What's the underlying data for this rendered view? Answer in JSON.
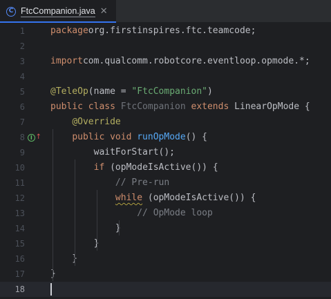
{
  "tab": {
    "file_icon_letter": "C",
    "title": "FtcCompanion.java",
    "close_glyph": "✕",
    "icon": "java-class-icon"
  },
  "editor": {
    "current_line": 18,
    "gutter_marker": {
      "line": 8,
      "letter": "I",
      "arrow": "↑",
      "icon": "implements-method-icon"
    },
    "lines": [
      {
        "num": "1",
        "tokens": [
          [
            "kw",
            "package"
          ],
          [
            "",
            "org.firstinspires.ftc.teamcode;"
          ]
        ]
      },
      {
        "num": "2",
        "tokens": []
      },
      {
        "num": "3",
        "tokens": [
          [
            "kw",
            "import"
          ],
          [
            "",
            "com.qualcomm.robotcore.eventloop.opmode.*;"
          ]
        ]
      },
      {
        "num": "4",
        "tokens": []
      },
      {
        "num": "5",
        "tokens": [
          [
            "ann",
            "@TeleOp"
          ],
          [
            "",
            "(name = "
          ],
          [
            "str",
            "\"FtcCompanion\""
          ],
          [
            "",
            ")"
          ]
        ]
      },
      {
        "num": "6",
        "tokens": [
          [
            "kw",
            "public class "
          ],
          [
            "dim",
            "FtcCompanion "
          ],
          [
            "kw",
            "extends "
          ],
          [
            "",
            "LinearOpMode {"
          ]
        ]
      },
      {
        "num": "7",
        "tokens": [
          [
            "",
            "    "
          ],
          [
            "ann",
            "@Override"
          ]
        ]
      },
      {
        "num": "8",
        "tokens": [
          [
            "",
            "    "
          ],
          [
            "kw",
            "public void "
          ],
          [
            "fn",
            "runOpMode"
          ],
          [
            "",
            "() {"
          ]
        ]
      },
      {
        "num": "9",
        "tokens": [
          [
            "",
            "        waitForStart();"
          ]
        ]
      },
      {
        "num": "10",
        "tokens": [
          [
            "",
            "        "
          ],
          [
            "kw",
            "if "
          ],
          [
            "",
            "(opModeIsActive()) {"
          ]
        ]
      },
      {
        "num": "11",
        "tokens": [
          [
            "",
            "            "
          ],
          [
            "cmt",
            "// Pre-run"
          ]
        ]
      },
      {
        "num": "12",
        "tokens": [
          [
            "",
            "            "
          ],
          [
            "kw warn-underline",
            "while"
          ],
          [
            "",
            " (opModeIsActive()) {"
          ]
        ]
      },
      {
        "num": "13",
        "tokens": [
          [
            "",
            "                "
          ],
          [
            "cmt",
            "// OpMode loop"
          ]
        ]
      },
      {
        "num": "14",
        "tokens": [
          [
            "",
            "            }"
          ]
        ]
      },
      {
        "num": "15",
        "tokens": [
          [
            "",
            "        }"
          ]
        ]
      },
      {
        "num": "16",
        "tokens": [
          [
            "",
            "    }"
          ]
        ]
      },
      {
        "num": "17",
        "tokens": [
          [
            "",
            "}"
          ]
        ]
      },
      {
        "num": "18",
        "tokens": []
      }
    ]
  }
}
